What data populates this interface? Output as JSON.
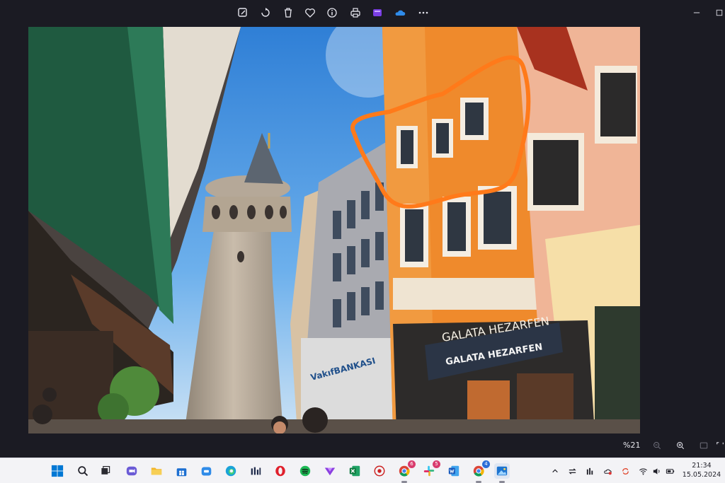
{
  "toolbar": {
    "icons": [
      "edit-icon",
      "rotate-icon",
      "delete-icon",
      "favorite-icon",
      "info-icon",
      "print-icon",
      "clipchamp-icon",
      "onedrive-icon",
      "more-icon"
    ]
  },
  "photo": {
    "sign_top": "GALATA HEZARFEN",
    "sign_awning": "GALATA HEZARFEN",
    "bank_sign": "VakıfBANKASI"
  },
  "statusbar": {
    "zoom_level": "%21"
  },
  "taskbar": {
    "badges": {
      "chrome": "6",
      "slack": "5",
      "chrome2": "4"
    },
    "clock_time": "21:34",
    "clock_date": "15.05.2024"
  },
  "colors": {
    "accent": "#0067c0",
    "annotation": "#ff7a1a",
    "background": "#1b1b23"
  }
}
